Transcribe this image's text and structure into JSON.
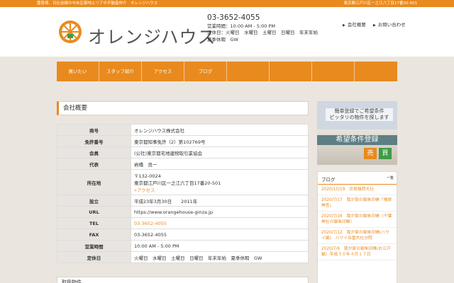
{
  "topbar": {
    "left": "慶喜様、日比谷線の中央区築地エリアの不動産仲介　オレンジハウス",
    "right": "東京都江戸川区一之江六丁目17番20-501"
  },
  "header": {
    "logo_text": "オレンジハウス",
    "phone": "03-3652-4055",
    "hours": "営業時間：10:00 AM - 5:00 PM",
    "holidays_1": "定休日：火曜日　水曜日　土曜日　日曜日　年末年始",
    "holidays_2": "夏季休暇　GW",
    "links": [
      "会社概要",
      "お問い合わせ"
    ]
  },
  "nav": [
    "買いたい",
    "スタッフ紹介",
    "アクセス",
    "ブログ",
    "",
    "",
    "",
    ""
  ],
  "page_title": "会社概要",
  "company": {
    "rows": [
      {
        "label": "商号",
        "value": "オレンジハウス株式会社"
      },
      {
        "label": "免許番号",
        "value": "東京都知事免許（2）第102769号"
      },
      {
        "label": "会員",
        "value": "(公社)東京都宅地建物取引業協会"
      },
      {
        "label": "代表",
        "value": "岩橋　良一"
      },
      {
        "label": "所在地",
        "value_1": "〒132-0024",
        "value_2": "東京都江戸川区一之江六丁目17番20-501",
        "value_3": "»アクセス"
      },
      {
        "label": "設立",
        "value": "平成23年3月30日　　2011年"
      },
      {
        "label": "URL",
        "value": "https://www.orangehouse-ginza.jp"
      },
      {
        "label": "TEL",
        "value": "03-3652-4055"
      },
      {
        "label": "FAX",
        "value": "03-3652-4055"
      },
      {
        "label": "営業時間",
        "value": "10:00 AM - 5:00 PM"
      },
      {
        "label": "定休日",
        "value": "火曜日　水曜日　土曜日　日曜日　年末年始　夏季休暇　GW"
      }
    ]
  },
  "section2": "取扱物件",
  "banner": {
    "copy_1": "簡単登録でご希望条件",
    "copy_2": "ピッタリの物件を探します",
    "strip": "希望条件登録",
    "badge_1": "売",
    "badge_2": "買"
  },
  "blog": {
    "title": "ブログ",
    "more": "一覧",
    "items": [
      "2020/10/19　伏見稲荷大社",
      "2020/7/17　我が家の御朱印帳「楼原神宮」",
      "2020/7/16　我が家の御朱印帳（千葉神社の御朱印帳）",
      "2020/7/12　我が家の御朱印帳(ハワイ編)　ハワイ出雲大社分院",
      "2020/7/6　我が家の御朱印帳(お江戸編）平成３０年４月１７日"
    ]
  },
  "colors": {
    "accent": "#e98a1e",
    "green": "#3e9b45"
  }
}
